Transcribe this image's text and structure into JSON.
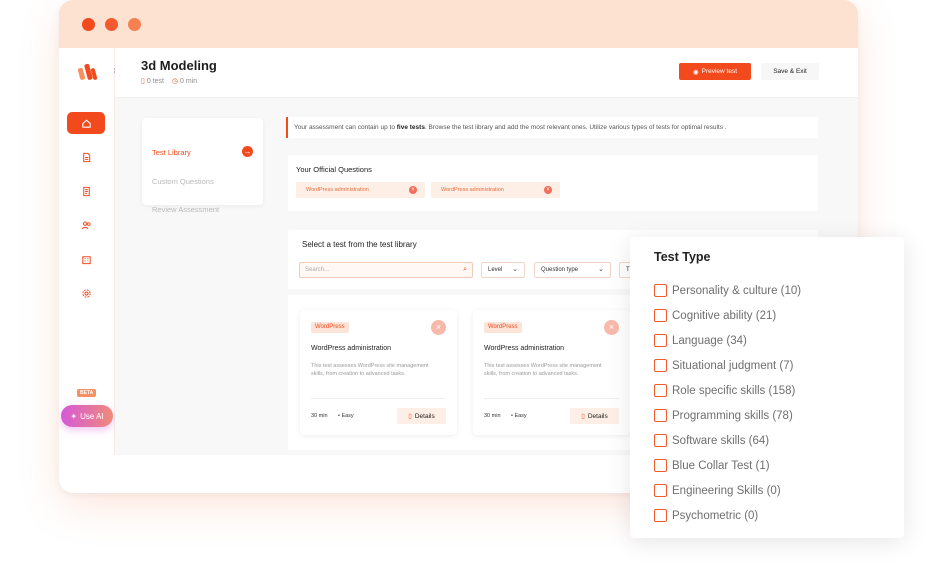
{
  "window": {
    "title": "3d Modeling",
    "tests_count": "0 test",
    "duration": "0 min"
  },
  "topbar": {
    "preview_label": "Preview test",
    "save_label": "Save & Exit"
  },
  "sidebar": {
    "beta_label": "BETA",
    "use_ai_label": "Use AI",
    "items": [
      {
        "icon": "home-icon",
        "active": true
      },
      {
        "icon": "document-icon"
      },
      {
        "icon": "report-icon"
      },
      {
        "icon": "users-icon"
      },
      {
        "icon": "building-icon"
      },
      {
        "icon": "gear-icon"
      }
    ]
  },
  "steps": {
    "library": "Test Library",
    "custom": "Custom Questions",
    "review": "Review Assessment"
  },
  "notice": {
    "before": "Your assessment can contain up to ",
    "bold": "five tests",
    "after": ". Browse the test library and add the most relevant ones. Utilize various types of tests for optimal results ."
  },
  "official": {
    "title": "Your Official Questions",
    "chips": [
      "WordPress administration",
      "WordPress administration"
    ]
  },
  "library": {
    "title": "Select a test from the test library",
    "search_placeholder": "Search...",
    "filters": {
      "level": "Level",
      "question_type": "Question type",
      "third": "T"
    },
    "cards": [
      {
        "tag": "WordPress",
        "name": "WordPress administration",
        "desc": "This test assesses WordPress site management skills, from creation to advanced tasks.",
        "duration": "30 min",
        "level": "• Easy",
        "details": "Details"
      },
      {
        "tag": "WordPress",
        "name": "WordPress administration",
        "desc": "This test assesses WordPress site management skills, from creation to advanced tasks.",
        "duration": "30 min",
        "level": "• Easy",
        "details": "Details"
      }
    ]
  },
  "test_type": {
    "title": "Test Type",
    "options": [
      "Personality & culture (10)",
      "Cognitive ability (21)",
      "Language (34)",
      "Situational judgment (7)",
      "Role specific skills (158)",
      "Programming skills (78)",
      "Software skills (64)",
      "Blue Collar Test (1)",
      "Engineering Skills (0)",
      "Psychometric (0)"
    ]
  },
  "colors": {
    "accent": "#f24a1d",
    "titlebar": "#fde2d2"
  }
}
